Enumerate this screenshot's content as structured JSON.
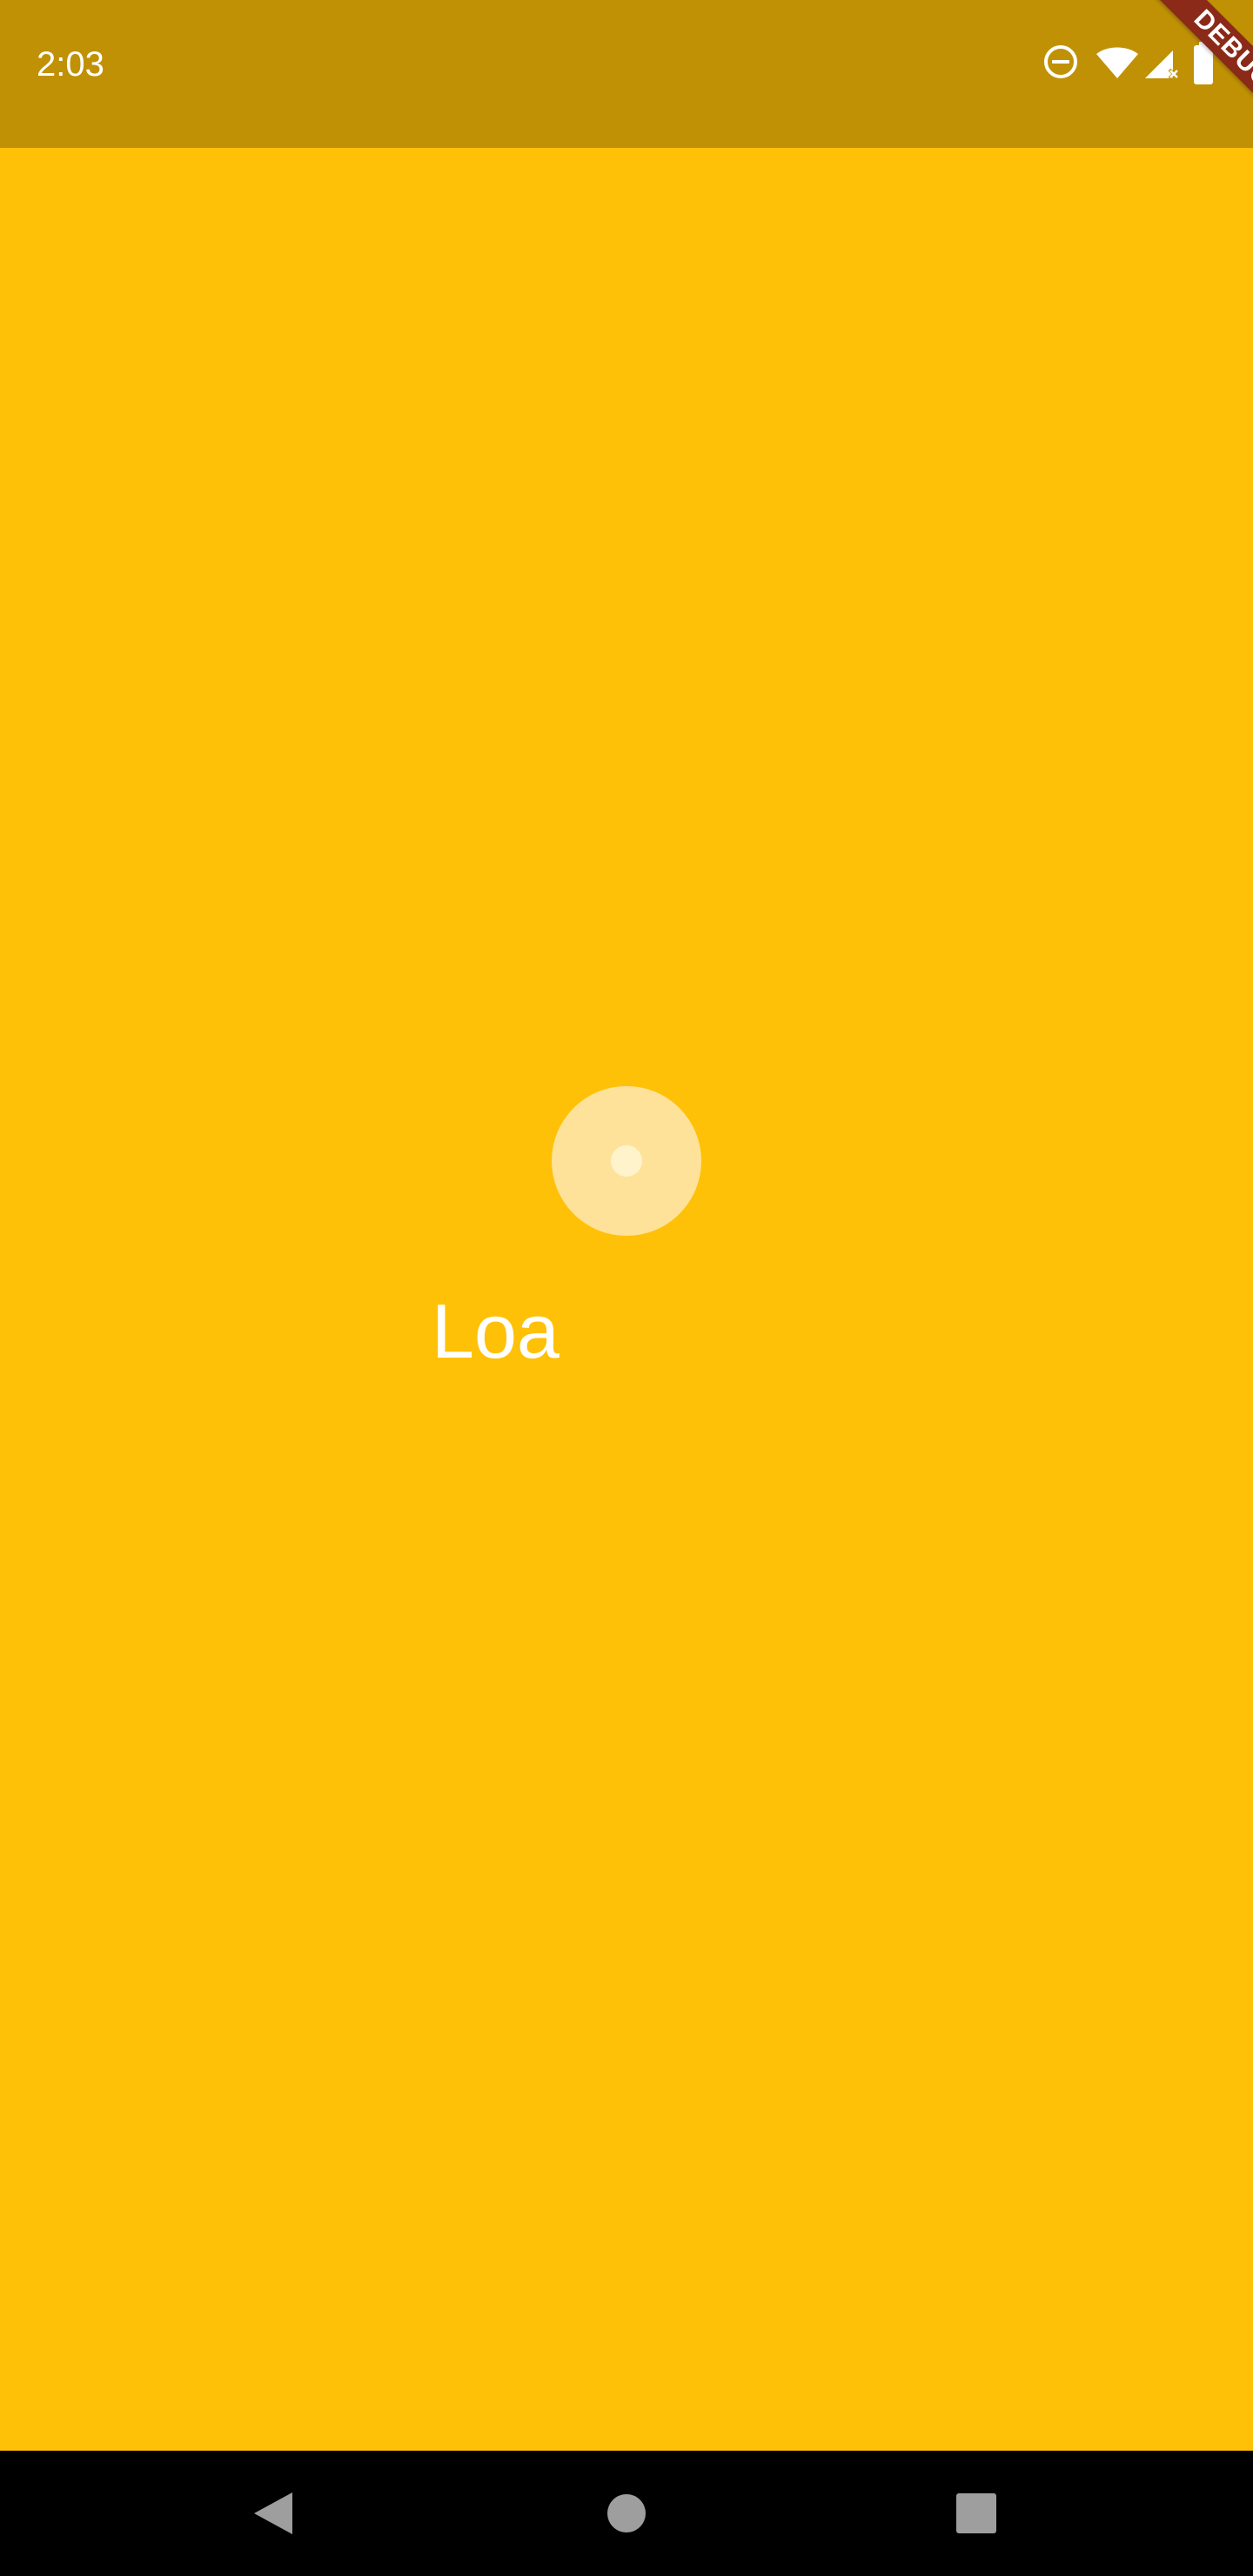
{
  "status_bar": {
    "time": "2:03",
    "icons": [
      "dnd-icon",
      "wifi-icon",
      "signal-icon",
      "battery-icon"
    ]
  },
  "debug_banner": {
    "label": "DEBUG",
    "color": "#8B2A18"
  },
  "main": {
    "loading_text": "Loa",
    "background_color": "#FFC107"
  },
  "navigation_bar": {
    "buttons": [
      "back-icon",
      "home-icon",
      "recents-icon"
    ]
  }
}
